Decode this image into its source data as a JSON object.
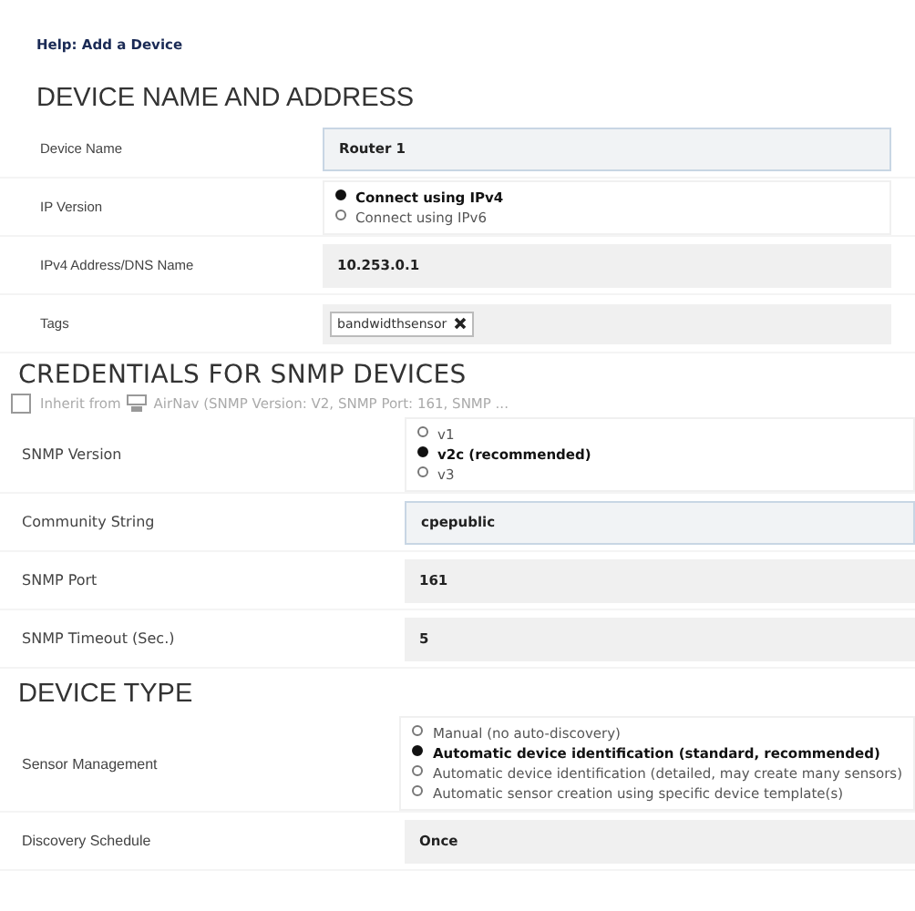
{
  "help_link": "Help: Add a Device",
  "sections": [
    {
      "title": "DEVICE NAME AND ADDRESS",
      "rows": [
        {
          "label": "Device Name",
          "kind": "input",
          "value": "Router 1",
          "focused": true
        },
        {
          "label": "IP Version",
          "kind": "radio",
          "options": [
            {
              "label": "Connect using IPv4",
              "selected": true
            },
            {
              "label": "Connect using IPv6",
              "selected": false
            }
          ]
        },
        {
          "label": "IPv4 Address/DNS Name",
          "kind": "input",
          "value": "10.253.0.1",
          "focused": false
        },
        {
          "label": "Tags",
          "kind": "tags",
          "tags": [
            "bandwidthsensor"
          ]
        }
      ]
    },
    {
      "title": "CREDENTIALS FOR SNMP DEVICES",
      "inherit": {
        "checked": false,
        "text": "Inherit from",
        "source": "AirNav (SNMP Version: V2, SNMP Port: 161, SNMP ..."
      },
      "rows": [
        {
          "label": "SNMP Version",
          "kind": "radio",
          "options": [
            {
              "label": "v1",
              "selected": false
            },
            {
              "label": "v2c (recommended)",
              "selected": true
            },
            {
              "label": "v3",
              "selected": false
            }
          ]
        },
        {
          "label": "Community String",
          "kind": "input",
          "value": "cpepublic",
          "focused": true
        },
        {
          "label": "SNMP Port",
          "kind": "input",
          "value": "161",
          "focused": false
        },
        {
          "label": "SNMP Timeout (Sec.)",
          "kind": "input",
          "value": "5",
          "focused": false
        }
      ]
    },
    {
      "title": "DEVICE TYPE",
      "rows": [
        {
          "label": "Sensor Management",
          "kind": "radio",
          "options": [
            {
              "label": "Manual (no auto-discovery)",
              "selected": false
            },
            {
              "label": "Automatic device identification (standard, recommended)",
              "selected": true
            },
            {
              "label": "Automatic device identification (detailed, may create many sensors)",
              "selected": false
            },
            {
              "label": "Automatic sensor creation using specific device template(s)",
              "selected": false
            }
          ]
        },
        {
          "label": "Discovery Schedule",
          "kind": "input",
          "value": "Once",
          "focused": false
        }
      ]
    }
  ]
}
